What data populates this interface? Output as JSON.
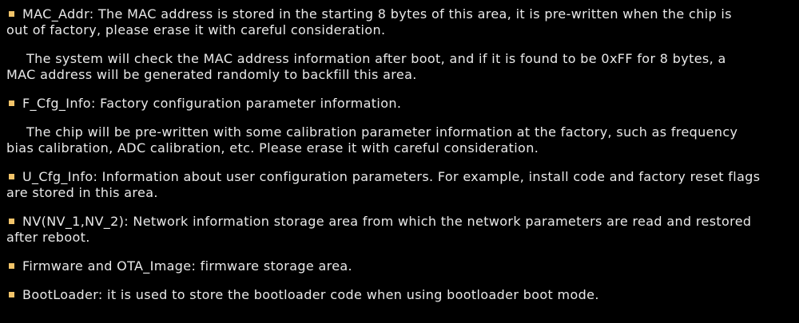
{
  "items": [
    {
      "type": "bullet",
      "line1": "MAC_Addr: The MAC address is stored in the starting 8 bytes of this area, it is pre-written when the chip is",
      "line2": "out of factory, please erase it with careful consideration."
    },
    {
      "type": "paragraph",
      "line1": "The system will check the MAC address information after boot, and if it is found to be 0xFF for 8 bytes, a",
      "line2": "MAC address will be generated randomly to backfill this area."
    },
    {
      "type": "bullet",
      "line1": "F_Cfg_Info: Factory configuration parameter information."
    },
    {
      "type": "paragraph",
      "line1": "The chip will be pre-written with some calibration parameter information at the factory, such as frequency",
      "line2": "bias calibration, ADC calibration, etc. Please erase it with careful consideration."
    },
    {
      "type": "bullet",
      "line1": "U_Cfg_Info: Information about user configuration parameters. For example, install code and factory reset flags",
      "line2": "are stored in this area."
    },
    {
      "type": "bullet",
      "line1": "NV(NV_1,NV_2): Network information storage area from which the network parameters are read and restored",
      "line2": "after reboot."
    },
    {
      "type": "bullet",
      "line1": "Firmware and OTA_Image: firmware storage area."
    },
    {
      "type": "bullet",
      "line1": "BootLoader: it is used to store the bootloader code when using bootloader boot mode."
    }
  ],
  "colors": {
    "background": "#000000",
    "text": "#e9e9e9",
    "bullet": "#f2c46a"
  }
}
